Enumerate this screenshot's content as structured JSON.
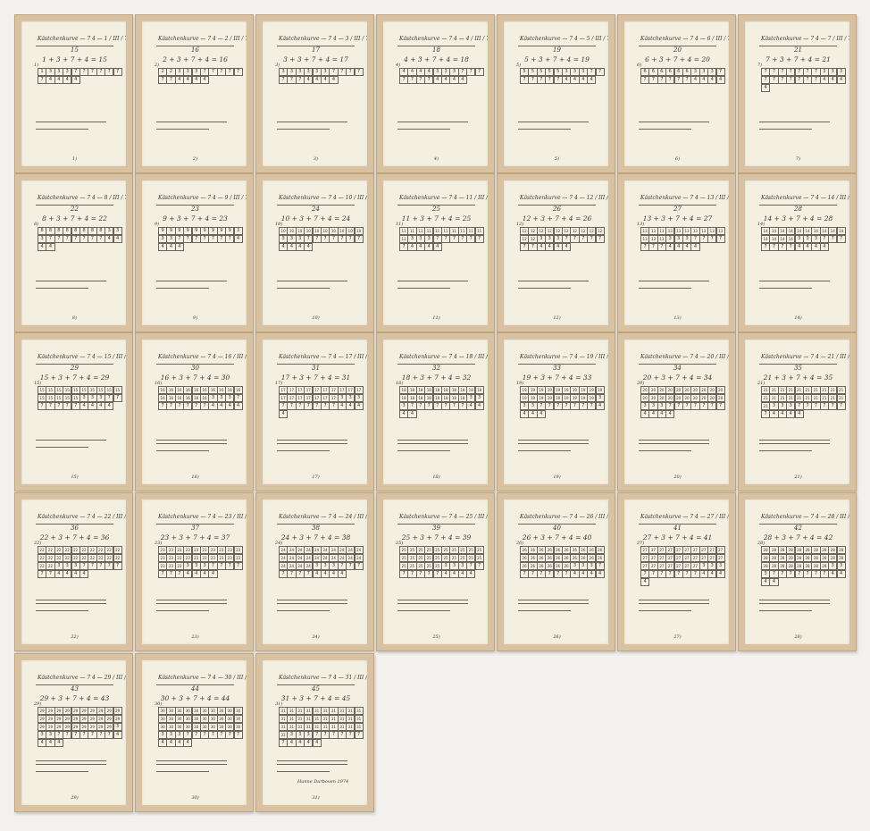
{
  "artwork": {
    "panel_title_prefix": "Kästchenkurve — 7 4 —",
    "panel_title_suffix": "/ III / 7 / 4",
    "signature": "Hanne Darboven 1974"
  },
  "panels": [
    {
      "day": "1",
      "header": "15",
      "equation": "1 + 3 + 7 + 4 = 15",
      "page": "1)"
    },
    {
      "day": "2",
      "header": "16",
      "equation": "2 + 3 + 7 + 4 = 16",
      "page": "2)"
    },
    {
      "day": "3",
      "header": "17",
      "equation": "3 + 3 + 7 + 4 = 17",
      "page": "3)"
    },
    {
      "day": "4",
      "header": "18",
      "equation": "4 + 3 + 7 + 4 = 18",
      "page": "4)"
    },
    {
      "day": "5",
      "header": "19",
      "equation": "5 + 3 + 7 + 4 = 19",
      "page": "5)"
    },
    {
      "day": "6",
      "header": "20",
      "equation": "6 + 3 + 7 + 4 = 20",
      "page": "6)"
    },
    {
      "day": "7",
      "header": "21",
      "equation": "7 + 3 + 7 + 4 = 21",
      "page": "7)"
    },
    {
      "day": "8",
      "header": "22",
      "equation": "8 + 3 + 7 + 4 = 22",
      "page": "8)"
    },
    {
      "day": "9",
      "header": "23",
      "equation": "9 + 3 + 7 + 4 = 23",
      "page": "9)"
    },
    {
      "day": "10",
      "header": "24",
      "equation": "10 + 3 + 7 + 4 = 24",
      "page": "10)"
    },
    {
      "day": "11",
      "header": "25",
      "equation": "11 + 3 + 7 + 4 = 25",
      "page": "11)"
    },
    {
      "day": "12",
      "header": "26",
      "equation": "12 + 3 + 7 + 4 = 26",
      "page": "12)"
    },
    {
      "day": "13",
      "header": "27",
      "equation": "13 + 3 + 7 + 4 = 27",
      "page": "13)"
    },
    {
      "day": "14",
      "header": "28",
      "equation": "14 + 3 + 7 + 4 = 28",
      "page": "14)"
    },
    {
      "day": "15",
      "header": "29",
      "equation": "15 + 3 + 7 + 4 = 29",
      "page": "15)"
    },
    {
      "day": "16",
      "header": "30",
      "equation": "16 + 3 + 7 + 4 = 30",
      "page": "16)"
    },
    {
      "day": "17",
      "header": "31",
      "equation": "17 + 3 + 7 + 4 = 31",
      "page": "17)"
    },
    {
      "day": "18",
      "header": "32",
      "equation": "18 + 3 + 7 + 4 = 32",
      "page": "18)"
    },
    {
      "day": "19",
      "header": "33",
      "equation": "19 + 3 + 7 + 4 = 33",
      "page": "19)"
    },
    {
      "day": "20",
      "header": "34",
      "equation": "20 + 3 + 7 + 4 = 34",
      "page": "20)"
    },
    {
      "day": "21",
      "header": "35",
      "equation": "21 + 3 + 7 + 4 = 35",
      "page": "21)"
    },
    {
      "day": "22",
      "header": "36",
      "equation": "22 + 3 + 7 + 4 = 36",
      "page": "22)"
    },
    {
      "day": "23",
      "header": "37",
      "equation": "23 + 3 + 7 + 4 = 37",
      "page": "23)"
    },
    {
      "day": "24",
      "header": "38",
      "equation": "24 + 3 + 7 + 4 = 38",
      "page": "24)"
    },
    {
      "day": "25",
      "header": "39",
      "equation": "25 + 3 + 7 + 4 = 39",
      "page": "25)"
    },
    {
      "day": "26",
      "header": "40",
      "equation": "26 + 3 + 7 + 4 = 40",
      "page": "26)"
    },
    {
      "day": "27",
      "header": "41",
      "equation": "27 + 3 + 7 + 4 = 41",
      "page": "27)"
    },
    {
      "day": "28",
      "header": "42",
      "equation": "28 + 3 + 7 + 4 = 42",
      "page": "28)"
    },
    {
      "day": "29",
      "header": "43",
      "equation": "29 + 3 + 7 + 4 = 43",
      "page": "29)"
    },
    {
      "day": "30",
      "header": "44",
      "equation": "30 + 3 + 7 + 4 = 44",
      "page": "30)"
    },
    {
      "day": "31",
      "header": "45",
      "equation": "31 + 3 + 7 + 4 = 45",
      "page": "31)"
    }
  ]
}
